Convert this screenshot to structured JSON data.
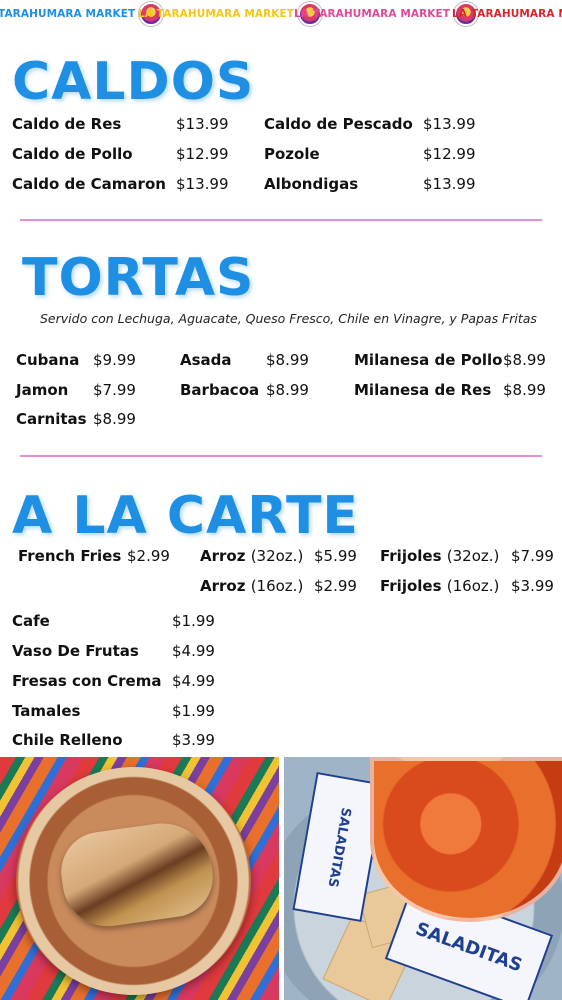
{
  "banner": {
    "items": [
      {
        "text": "TARAHUMARA MARKET",
        "color": "#1e8fe3"
      },
      {
        "text": "LA TARAHUMARA MARKET",
        "color": "#f5c518"
      },
      {
        "text": "LA TARAHUMARA MARKET",
        "color": "#e0489c"
      },
      {
        "text": "LA TARAHUMARA MAR",
        "color": "#d9262b"
      }
    ]
  },
  "caldos": {
    "title": "CALDOS",
    "col1": [
      {
        "name": "Caldo de Res",
        "price": "$13.99"
      },
      {
        "name": "Caldo de Pollo",
        "price": "$12.99"
      },
      {
        "name": "Caldo de Camaron",
        "price": "$13.99"
      }
    ],
    "col2": [
      {
        "name": "Caldo de Pescado",
        "price": "$13.99"
      },
      {
        "name": "Pozole",
        "price": "$12.99"
      },
      {
        "name": "Albondigas",
        "price": "$13.99"
      }
    ]
  },
  "tortas": {
    "title": "TORTAS",
    "subtitle": "Servido con Lechuga, Aguacate, Queso Fresco, Chile en Vinagre, y Papas Fritas",
    "col1": [
      {
        "name": "Cubana",
        "price": "$9.99"
      },
      {
        "name": "Jamon",
        "price": "$7.99"
      },
      {
        "name": "Carnitas",
        "price": "$8.99"
      }
    ],
    "col2": [
      {
        "name": "Asada",
        "price": "$8.99"
      },
      {
        "name": "Barbacoa",
        "price": "$8.99"
      }
    ],
    "col3": [
      {
        "name": "Milanesa de Pollo",
        "price": "$8.99"
      },
      {
        "name": "Milanesa de Res",
        "price": "$8.99"
      }
    ]
  },
  "alacarte": {
    "title": "A LA CARTE",
    "french_fries": {
      "name": "French Fries",
      "price": "$2.99"
    },
    "arroz32": {
      "name": "Arroz",
      "size": "(32oz.)",
      "price": "$5.99"
    },
    "arroz16": {
      "name": "Arroz",
      "size": "(16oz.)",
      "price": "$2.99"
    },
    "frijoles32": {
      "name": "Frijoles",
      "size": "(32oz.)",
      "price": "$7.99"
    },
    "frijoles16": {
      "name": "Frijoles",
      "size": "(16oz.)",
      "price": "$3.99"
    },
    "list": [
      {
        "name": "Cafe",
        "price": "$1.99"
      },
      {
        "name": "Vaso De Frutas",
        "price": "$4.99"
      },
      {
        "name": "Fresas con Crema",
        "price": "$4.99"
      },
      {
        "name": "Tamales",
        "price": "$1.99"
      },
      {
        "name": "Chile Relleno",
        "price": "$3.99"
      }
    ]
  },
  "photos": {
    "cracker_brand": "SALADITAS"
  },
  "colors": {
    "title_blue": "#1e8fe3",
    "divider_pink": "#e58fd3"
  }
}
